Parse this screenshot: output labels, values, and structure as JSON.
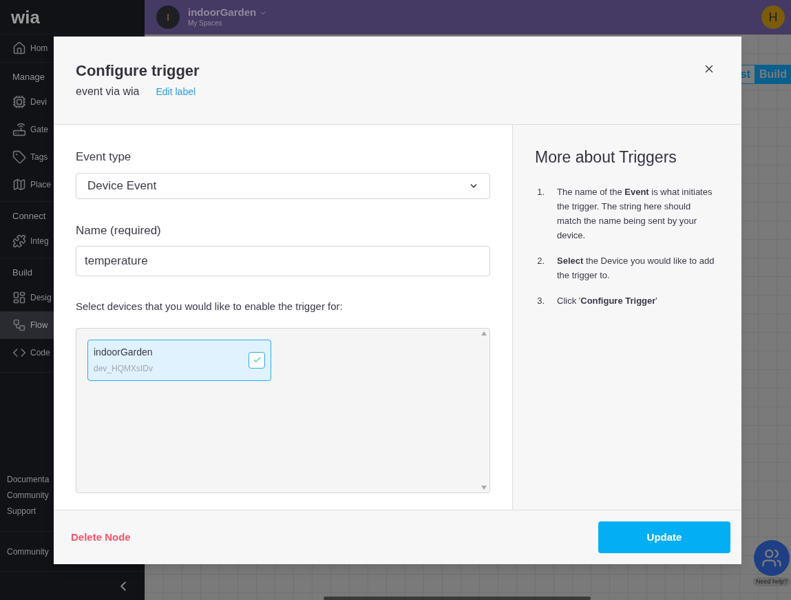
{
  "sidebar": {
    "logo": "wia",
    "items": [
      {
        "kind": "item",
        "label": "Hom",
        "selected": false
      },
      {
        "kind": "section",
        "label": "Manage"
      },
      {
        "kind": "item",
        "label": "Devi",
        "selected": false
      },
      {
        "kind": "item",
        "label": "Gate",
        "selected": false
      },
      {
        "kind": "item",
        "label": "Tags",
        "selected": false
      },
      {
        "kind": "item",
        "label": "Place",
        "selected": false
      },
      {
        "kind": "section",
        "label": "Connect"
      },
      {
        "kind": "item",
        "label": "Integ",
        "selected": false
      },
      {
        "kind": "section",
        "label": "Build"
      },
      {
        "kind": "item",
        "label": "Desig",
        "selected": false
      },
      {
        "kind": "item",
        "label": "Flow",
        "selected": true
      },
      {
        "kind": "item",
        "label": "Code",
        "selected": false
      }
    ],
    "footer_links": [
      "Documenta",
      "Community",
      "Support"
    ],
    "community": "Community"
  },
  "topbar": {
    "space_initial": "I",
    "space_name": "indoorGarden",
    "space_subtitle": "My Spaces",
    "user_initial": "H"
  },
  "canvas": {
    "mode_tabs": [
      {
        "label": "st",
        "selected": false
      },
      {
        "label": "Build",
        "selected": true
      }
    ],
    "help": "Need help?"
  },
  "modal": {
    "title": "Configure trigger",
    "subtitle": "event via wia",
    "edit_label": "Edit label",
    "event_type": {
      "label": "Event type",
      "value": "Device Event"
    },
    "name": {
      "label": "Name (required)",
      "value": "temperature"
    },
    "devices": {
      "label": "Select devices that you would like to enable the trigger for:",
      "items": [
        {
          "name": "indoorGarden",
          "id": "dev_HQMXsIDv",
          "checked": true
        }
      ]
    },
    "help": {
      "title": "More about Triggers",
      "steps": [
        {
          "number": "1.",
          "text": "The name of the **Event** is what initiates the trigger. The string here should match the name being sent by your device."
        },
        {
          "number": "2.",
          "text": "**Select** the Device you would like to add the trigger to."
        },
        {
          "number": "3.",
          "text": "Click '**Configure Trigger**'"
        }
      ]
    },
    "delete": "Delete Node",
    "update": "Update"
  }
}
